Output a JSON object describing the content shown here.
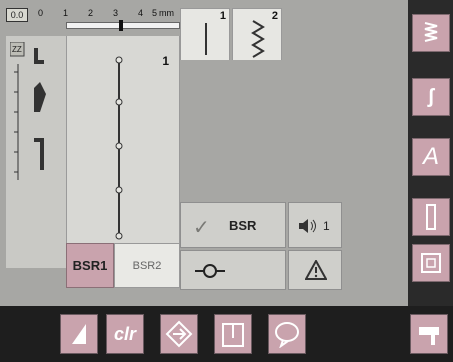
{
  "ruler": {
    "box_label": "0.0",
    "ticks": [
      "0",
      "1",
      "2",
      "3",
      "4",
      "5"
    ],
    "unit": "mm"
  },
  "stitch_panel": {
    "segment_number": "1"
  },
  "tabs": {
    "bsr1_label": "BSR1",
    "bsr2_label": "BSR2"
  },
  "patterns": [
    {
      "number": "1",
      "icon": "straight-stitch-icon"
    },
    {
      "number": "2",
      "icon": "zigzag-stitch-icon"
    }
  ],
  "bsr_button": {
    "label": "BSR",
    "icon": "checkmark-icon"
  },
  "volume_button": {
    "label": "1",
    "icon": "speaker-icon"
  },
  "sidebar": {
    "items": [
      "stitch-menu-icon",
      "quick-stitch-icon",
      "alphabet-icon",
      "buttonhole-icon",
      "quilt-icon"
    ],
    "alphabet_label": "A"
  },
  "bottom_bar": {
    "clr_label": "clr"
  },
  "colors": {
    "accent": "#c9a3ad",
    "background": "#a7a7a4"
  }
}
